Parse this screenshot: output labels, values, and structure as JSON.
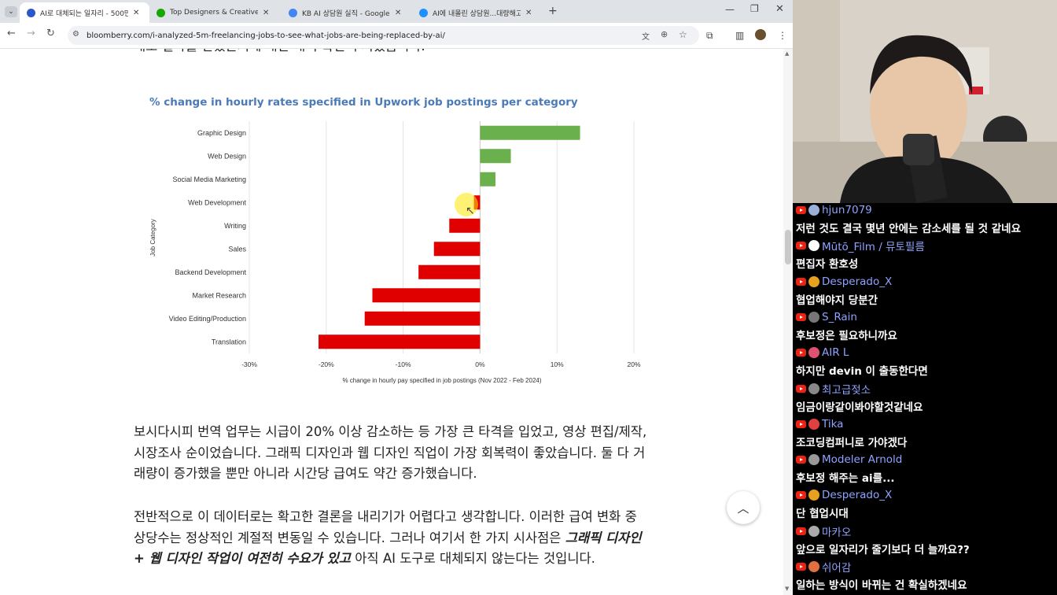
{
  "browser": {
    "tabs": [
      {
        "title": "AI로 대체되는 일자리 - 500만",
        "active": true,
        "color": "#2b57c9"
      },
      {
        "title": "Top Designers & Creatives for",
        "active": false,
        "color": "#14a800"
      },
      {
        "title": "KB AI 상담원 실직 - Google 검",
        "active": false,
        "color": "#4285f4"
      },
      {
        "title": "AI에 내몰린 상담원...대량해고",
        "active": false,
        "color": "#1e90ff"
      }
    ],
    "url": "bloomberry.com/i-analyzed-5m-freelancing-jobs-to-see-what-jobs-are-being-replaced-by-ai/"
  },
  "article": {
    "top_partial_line": "새로 얼마를 받았는지에 대한 내역 확인 두시겠습니다.",
    "paragraph1": "보시다시피 번역 업무는 시급이 20% 이상 감소하는 등 가장 큰 타격을 입었고, 영상 편집/제작, 시장조사 순이었습니다. 그래픽 디자인과 웹 디자인 직업이 가장 회복력이 좋았습니다. 둘 다 거래량이 증가했을 뿐만 아니라 시간당 급여도 약간 증가했습니다.",
    "paragraph2_start": "전반적으로 이 데이터로는 확고한 결론을 내리기가 어렵다고 생각합니다. 이러한 급여 변화 중 상당수는 정상적인 계절적 변동일 수 있습니다. 그러나 여기서 한 가지 시사점은 ",
    "paragraph2_bold": "그래픽 디자인 + 웹 디자인 작업이 여전히 수요가 있고",
    "paragraph2_end": " 아직 AI 도구로 대체되지 않는다는 것입니다."
  },
  "chart_data": {
    "type": "bar",
    "orientation": "horizontal",
    "title": "% change in hourly rates specified in Upwork job postings per category",
    "xlabel": "% change in hourly pay specified in job postings (Nov 2022 - Feb 2024)",
    "ylabel": "Job Category",
    "categories": [
      "Graphic Design",
      "Web Design",
      "Social Media Marketing",
      "Web Development",
      "Writing",
      "Sales",
      "Backend Development",
      "Market Research",
      "Video Editing/Production",
      "Translation"
    ],
    "values": [
      13,
      4,
      2,
      -0.8,
      -4,
      -6,
      -8,
      -14,
      -15,
      -21
    ],
    "xlim": [
      -30,
      20
    ],
    "xticks": [
      -30,
      -20,
      -10,
      0,
      10,
      20
    ],
    "xtick_labels": [
      "-30%",
      "-20%",
      "-10%",
      "0%",
      "10%",
      "20%"
    ],
    "positive_color": "#6ab04c",
    "negative_color": "#e00000",
    "grid": true
  },
  "chat": {
    "messages": [
      {
        "user": "hjun7079",
        "text": "저런 것도 결국 몇년 안에는 감소세를 될 것 같네요",
        "avatar": "#9ab0d8"
      },
      {
        "user": "Mūtō_Film / 뮤토필름",
        "text": "편집자 환호성",
        "avatar": "#ffffff"
      },
      {
        "user": "Desperado_X",
        "text": "협업해야지 당분간",
        "avatar": "#e8a020"
      },
      {
        "user": "S_Rain",
        "text": "후보정은 필요하니까요",
        "avatar": "#777777"
      },
      {
        "user": "AIR L",
        "text": "하지만 devin 이 출동한다면",
        "avatar": "#e05070"
      },
      {
        "user": "최고급젖소",
        "text": "임금이랑같이봐야할것같네요",
        "avatar": "#888888"
      },
      {
        "user": "Tika",
        "text": "조코딩컴퍼니로 가야겠다",
        "avatar": "#e04040"
      },
      {
        "user": "Modeler Arnold",
        "text": "후보정 해주는 ai를...",
        "avatar": "#999999"
      },
      {
        "user": "Desperado_X",
        "text": "단 협업시대",
        "avatar": "#e8a020"
      },
      {
        "user": "마카오",
        "text": "앞으로 일자리가 줄기보다 더 늘까요??",
        "avatar": "#aaaaaa"
      },
      {
        "user": "쉬어감",
        "text": "일하는 방식이 바뀌는 건 확실하겠네요",
        "avatar": "#e07040"
      }
    ]
  },
  "icons": [
    "tab-list-icon",
    "back-arrow-icon",
    "forward-arrow-icon",
    "reload-icon",
    "site-settings-icon",
    "translate-icon",
    "zoom-icon",
    "star-icon",
    "extensions-icon",
    "side-panel-icon",
    "profile-avatar",
    "menu-icon",
    "scroll-to-top-icon"
  ]
}
